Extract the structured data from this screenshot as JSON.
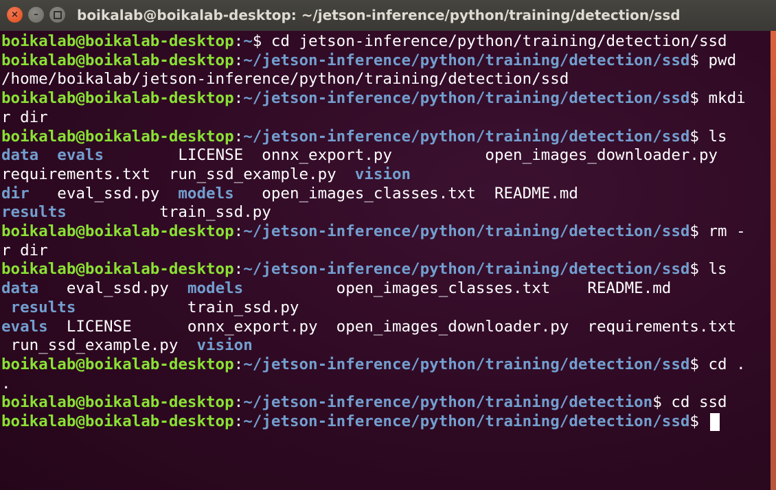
{
  "window": {
    "title": "boikalab@boikalab-desktop: ~/jetson-inference/python/training/detection/ssd",
    "close_glyph": "×",
    "min_glyph": "–"
  },
  "colors": {
    "prompt_user": "#8ae234",
    "prompt_path": "#729fcf",
    "text": "#ffffff",
    "background": "#300a24",
    "close_button": "#df4a16"
  },
  "prompt": {
    "user": "boikalab@boikalab-desktop",
    "colon": ":",
    "dollar": "$"
  },
  "lines": [
    {
      "path": "~",
      "cmd": " cd jetson-inference/python/training/detection/ssd"
    },
    {
      "path": "~/jetson-inference/python/training/detection/ssd",
      "cmd": " pwd"
    },
    {
      "text": "/home/boikalab/jetson-inference/python/training/detection/ssd"
    },
    {
      "path": "~/jetson-inference/python/training/detection/ssd",
      "cmd": " mkdi"
    },
    {
      "text": "r dir"
    },
    {
      "path": "~/jetson-inference/python/training/detection/ssd",
      "cmd": " ls"
    },
    {
      "segments": [
        {
          "t": "data",
          "dir": true
        },
        {
          "t": "  "
        },
        {
          "t": "evals",
          "dir": true
        },
        {
          "t": "        LICENSE  onnx_export.py          open_images_downloader.py"
        }
      ]
    },
    {
      "segments": [
        {
          "t": "requirements.txt  run_ssd_example.py  "
        },
        {
          "t": "vision",
          "dir": true
        }
      ]
    },
    {
      "segments": [
        {
          "t": "dir",
          "dir": true
        },
        {
          "t": "   eval_ssd.py  "
        },
        {
          "t": "models",
          "dir": true
        },
        {
          "t": "   open_images_classes.txt  README.md"
        }
      ]
    },
    {
      "segments": [
        {
          "t": "results",
          "dir": true
        },
        {
          "t": "          train_ssd.py"
        }
      ]
    },
    {
      "path": "~/jetson-inference/python/training/detection/ssd",
      "cmd": " rm -"
    },
    {
      "text": "r dir"
    },
    {
      "path": "~/jetson-inference/python/training/detection/ssd",
      "cmd": " ls"
    },
    {
      "segments": [
        {
          "t": "data",
          "dir": true
        },
        {
          "t": "   eval_ssd.py  "
        },
        {
          "t": "models",
          "dir": true
        },
        {
          "t": "          open_images_classes.txt    README.md"
        }
      ]
    },
    {
      "segments": [
        {
          "t": " "
        },
        {
          "t": "results",
          "dir": true
        },
        {
          "t": "            train_ssd.py"
        }
      ]
    },
    {
      "segments": [
        {
          "t": "evals",
          "dir": true
        },
        {
          "t": "  LICENSE      onnx_export.py  open_images_downloader.py  requirements.txt"
        }
      ]
    },
    {
      "segments": [
        {
          "t": " run_ssd_example.py  "
        },
        {
          "t": "vision",
          "dir": true
        }
      ]
    },
    {
      "path": "~/jetson-inference/python/training/detection/ssd",
      "cmd": " cd ."
    },
    {
      "text": "."
    },
    {
      "path": "~/jetson-inference/python/training/detection",
      "cmd": " cd ssd"
    },
    {
      "path": "~/jetson-inference/python/training/detection/ssd",
      "cmd": " ",
      "cursor": true
    }
  ]
}
